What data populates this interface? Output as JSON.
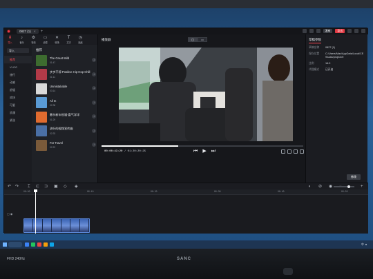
{
  "app": {
    "tab_title": "0827 (1)",
    "tab_close": "×",
    "new_tab": "+",
    "btn_red": "导出",
    "btn_dark": "发布",
    "logo_glyph": "◉"
  },
  "toolbar": [
    {
      "glyph": "⬇",
      "label": "导入",
      "icon": "import-icon"
    },
    {
      "glyph": "♪",
      "label": "音乐",
      "icon": "music-icon"
    },
    {
      "glyph": "⚙",
      "label": "特效",
      "icon": "effects-icon"
    },
    {
      "glyph": "▭",
      "label": "滤镜",
      "icon": "filter-icon"
    },
    {
      "glyph": "✕",
      "label": "转场",
      "icon": "transition-icon"
    },
    {
      "glyph": "T",
      "label": "文字",
      "icon": "text-icon"
    },
    {
      "glyph": "◷",
      "label": "贴纸",
      "icon": "sticker-icon"
    }
  ],
  "sidebar": {
    "top_button": "导入",
    "items": [
      {
        "label": "推荐",
        "active": true
      },
      {
        "label": "VLOG",
        "active": false
      },
      {
        "label": "旅行",
        "active": false
      },
      {
        "label": "动感",
        "active": false
      },
      {
        "label": "舒缓",
        "active": false
      },
      {
        "label": "欢快",
        "active": false
      },
      {
        "label": "可爱",
        "active": false
      },
      {
        "label": "浪漫",
        "active": false
      },
      {
        "label": "紧张",
        "active": false
      }
    ]
  },
  "library": {
    "heading": "推荐",
    "tracks": [
      {
        "name": "The Great Wild",
        "duration": "01:47",
        "color": "#3d6b2f"
      },
      {
        "name": "步步不停 Positive Hip-Hop Chill",
        "duration": "01:11",
        "color": "#b23a48"
      },
      {
        "name": "Unmistakable",
        "duration": "03:14",
        "color": "#d9d9d9"
      },
      {
        "name": "All In",
        "duration": "02:38",
        "color": "#5a9bd5"
      },
      {
        "name": "春节新年祝福-喜气洋洋",
        "duration": "01:29",
        "color": "#e06b2f"
      },
      {
        "name": "流行的视频宣传曲",
        "duration": "02:33",
        "color": "#4a6fa5"
      },
      {
        "name": "For Travel",
        "duration": "02:22",
        "color": "#7a5a3a"
      }
    ],
    "download_glyph": "↓"
  },
  "player": {
    "title": "播放器",
    "ratio_options": [
      "▢",
      "▭"
    ],
    "time_current": "00:00:43:20",
    "time_total": "/ 01:20:20:25",
    "progress": 0.38,
    "controls": [
      "⏮",
      "▶",
      "⏭"
    ]
  },
  "properties": {
    "tab": "草稿参数",
    "rows": [
      {
        "key": "草稿名称",
        "value": "0827 (1)"
      },
      {
        "key": "保存位置",
        "value": "C:/Users/Mac/AppData/Local/CE Studio/project/0"
      },
      {
        "key": "比例",
        "value": "16:9"
      },
      {
        "key": "代理模式",
        "value": "已开启"
      }
    ],
    "export_btn": "修改"
  },
  "timeline": {
    "ruler": [
      "00:00",
      "00:10",
      "00:20",
      "00:30",
      "00:40",
      "00:50"
    ],
    "track_controls": "▢ ◉",
    "playhead": 0.085
  },
  "taskbar": {
    "tray_text": "中  ▲"
  },
  "monitor": {
    "brand": "SANC",
    "badges": "FHD  240Hz"
  }
}
